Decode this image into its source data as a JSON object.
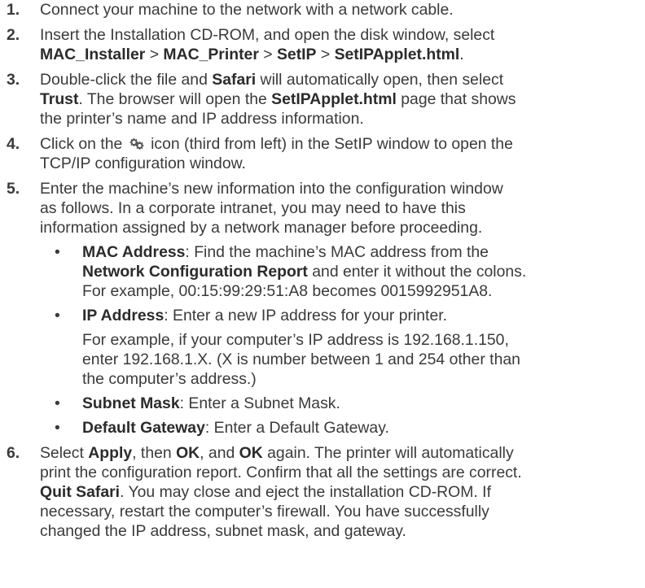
{
  "steps": [
    {
      "num": "1.",
      "lines": [
        [
          {
            "t": "Connect your machine to the network with a network cable."
          }
        ]
      ]
    },
    {
      "num": "2.",
      "lines": [
        [
          {
            "t": "Insert the Installation CD-ROM, and open the disk window, select"
          }
        ],
        [
          {
            "t": "MAC_Installer",
            "b": true
          },
          {
            "t": " > "
          },
          {
            "t": "MAC_Printer",
            "b": true
          },
          {
            "t": " > "
          },
          {
            "t": "SetIP",
            "b": true
          },
          {
            "t": " > "
          },
          {
            "t": "SetIPApplet.html",
            "b": true
          },
          {
            "t": "."
          }
        ]
      ]
    },
    {
      "num": "3.",
      "lines": [
        [
          {
            "t": "Double-click the file and "
          },
          {
            "t": "Safari",
            "b": true
          },
          {
            "t": " will automatically open, then select"
          }
        ],
        [
          {
            "t": "Trust",
            "b": true
          },
          {
            "t": ". The browser will open the "
          },
          {
            "t": "SetIPApplet.html",
            "b": true
          },
          {
            "t": " page that shows"
          }
        ],
        [
          {
            "t": "the printer’s name and IP address information."
          }
        ]
      ]
    },
    {
      "num": "4.",
      "lines": [
        [
          {
            "t": "Click on the "
          },
          {
            "icon": "gear-icon"
          },
          {
            "t": " icon (third from left) in the SetIP window to open the"
          }
        ],
        [
          {
            "t": "TCP/IP configuration window."
          }
        ]
      ]
    },
    {
      "num": "5.",
      "lines": [
        [
          {
            "t": "Enter the machine’s new information into the configuration window"
          }
        ],
        [
          {
            "t": "as follows. In a corporate intranet, you may need to have this"
          }
        ],
        [
          {
            "t": "information assigned by a network manager before proceeding."
          }
        ]
      ],
      "bullets": [
        {
          "lines": [
            [
              {
                "t": "MAC Address",
                "b": true
              },
              {
                "t": ": Find the machine’s MAC address from the"
              }
            ],
            [
              {
                "t": "Network Configuration Report",
                "b": true
              },
              {
                "t": " and enter it without the colons."
              }
            ],
            [
              {
                "t": "For example, 00:15:99:29:51:A8 becomes 0015992951A8."
              }
            ]
          ]
        },
        {
          "lines": [
            [
              {
                "t": "IP Address",
                "b": true
              },
              {
                "t": ": Enter a new IP address for your printer."
              }
            ]
          ],
          "extra": [
            [
              {
                "t": "For example, if your computer’s IP address is 192.168.1.150,"
              }
            ],
            [
              {
                "t": "enter 192.168.1.X. (X is number between 1 and 254 other than"
              }
            ],
            [
              {
                "t": "the computer’s address.)"
              }
            ]
          ]
        },
        {
          "lines": [
            [
              {
                "t": "Subnet Mask",
                "b": true
              },
              {
                "t": ": Enter a Subnet Mask."
              }
            ]
          ]
        },
        {
          "lines": [
            [
              {
                "t": "Default Gateway",
                "b": true
              },
              {
                "t": ": Enter a Default Gateway."
              }
            ]
          ]
        }
      ]
    },
    {
      "num": "6.",
      "lines": [
        [
          {
            "t": "Select "
          },
          {
            "t": "Apply",
            "b": true
          },
          {
            "t": ", then "
          },
          {
            "t": "OK",
            "b": true
          },
          {
            "t": ", and "
          },
          {
            "t": "OK",
            "b": true
          },
          {
            "t": " again. The printer will automatically"
          }
        ],
        [
          {
            "t": "print the configuration report. Confirm that all the settings are correct."
          }
        ],
        [
          {
            "t": "Quit Safari",
            "b": true
          },
          {
            "t": ". You may close and eject the installation CD-ROM. If"
          }
        ],
        [
          {
            "t": "necessary, restart the computer’s firewall. You have successfully"
          }
        ],
        [
          {
            "t": "changed the IP address, subnet mask, and gateway."
          }
        ]
      ]
    }
  ],
  "bullet_glyph": "•",
  "colors": {
    "text": "#3a3a3a",
    "bold": "#2b2b2b",
    "icon": "#555555"
  }
}
